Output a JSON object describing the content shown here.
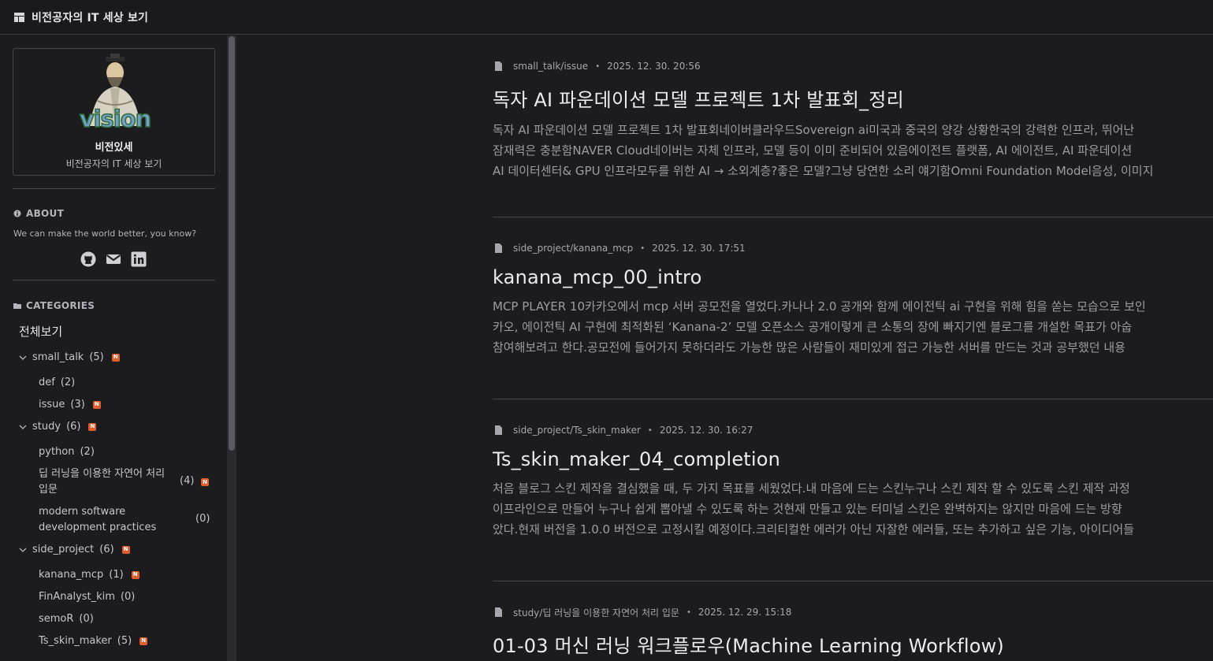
{
  "header": {
    "title": "비전공자의 IT 세상 보기"
  },
  "profile": {
    "name": "비전있세",
    "subtitle": "비전공자의 IT 세상 보기",
    "avatar_text": "vision"
  },
  "about": {
    "heading": "ABOUT",
    "text": "We can make the world better, you know?",
    "icons": [
      "github-icon",
      "mail-icon",
      "linkedin-icon"
    ]
  },
  "categories": {
    "heading": "CATEGORIES",
    "all_label": "전체보기",
    "small_talk": {
      "label": "small_talk",
      "count": "(5)"
    },
    "def": {
      "label": "def",
      "count": "(2)"
    },
    "issue": {
      "label": "issue",
      "count": "(3)"
    },
    "study": {
      "label": "study",
      "count": "(6)"
    },
    "python": {
      "label": "python",
      "count": "(2)"
    },
    "nlp": {
      "label": "딥 러닝을 이용한 자연어 처리 입문",
      "count": "(4)"
    },
    "msd": {
      "label": "modern software development practices",
      "count": "(0)"
    },
    "side_project": {
      "label": "side_project",
      "count": "(6)"
    },
    "kanana_mcp": {
      "label": "kanana_mcp",
      "count": "(1)"
    },
    "finanalyst": {
      "label": "FinAnalyst_kim",
      "count": "(0)"
    },
    "semor": {
      "label": "semoR",
      "count": "(0)"
    },
    "ts_skin_maker": {
      "label": "Ts_skin_maker",
      "count": "(5)"
    },
    "new_badge": "N"
  },
  "posts": [
    {
      "category": "small_talk/issue",
      "date": "2025. 12. 30. 20:56",
      "title": "독자 AI 파운데이션 모델 프로젝트 1차 발표회_정리",
      "excerpt_1": "독자 AI 파운데이션 모델 프로젝트 1차 발표회네이버클라우드Sovereign ai미국과 중국의 양강 상황한국의 강력한 인프라, 뛰어난",
      "excerpt_2": "잠재력은 충분함NAVER Cloud네이버는 자체 인프라, 모델 등이 이미 준비되어 있음에이전트 플랫폼, AI 에이전트, AI 파운데이션",
      "excerpt_3": "AI 데이터센터& GPU 인프라모두를 위한 AI → 소외계층?좋은 모델?그냥 당연한 소리 얘기함Omni Foundation Model음성, 이미지"
    },
    {
      "category": "side_project/kanana_mcp",
      "date": "2025. 12. 30. 17:51",
      "title": "kanana_mcp_00_intro",
      "excerpt_1": "MCP PLAYER 10카카오에서 mcp 서버 공모전을 열었다.카나나 2.0 공개와 함께 에이전틱 ai 구현을 위해 힘을 쏟는 모습으로 보인",
      "excerpt_2": "카오, 에이전틱 AI 구현에 최적화된 ‘Kanana-2’ 모델 오픈소스 공개이렇게 큰 소통의 장에 빠지기엔 블로그를 개설한 목표가 아숩",
      "excerpt_3": "참여해보려고 한다.공모전에 들어가지 못하더라도 가능한 많은 사람들이 재미있게 접근 가능한 서버를 만드는 것과 공부했던 내용"
    },
    {
      "category": "side_project/Ts_skin_maker",
      "date": "2025. 12. 30. 16:27",
      "title": "Ts_skin_maker_04_completion",
      "excerpt_1": "처음 블로그 스킨 제작을 결심했을 때, 두 가지 목표를 세웠었다.내 마음에 드는 스킨누구나 스킨 제작 할 수 있도록 스킨 제작 과정",
      "excerpt_2": "이프라인으로 만들어 누구나 쉽게 뽑아낼 수 있도록 하는 것현재 만들고 있는 터미널 스킨은 완벽하지는 않지만 마음에 드는 방향",
      "excerpt_3": "았다.현재 버전을 1.0.0 버전으로 고정시킬 예정이다.크리티컬한 에러가 아닌 자잘한 에러들, 또는 추가하고 싶은 기능, 아이디어들"
    },
    {
      "category": "study/딥 러닝을 이용한 자연어 처리 입문",
      "date": "2025. 12. 29. 15:18",
      "title": "01-03 머신 러닝 워크플로우(Machine Learning Workflow)"
    }
  ]
}
